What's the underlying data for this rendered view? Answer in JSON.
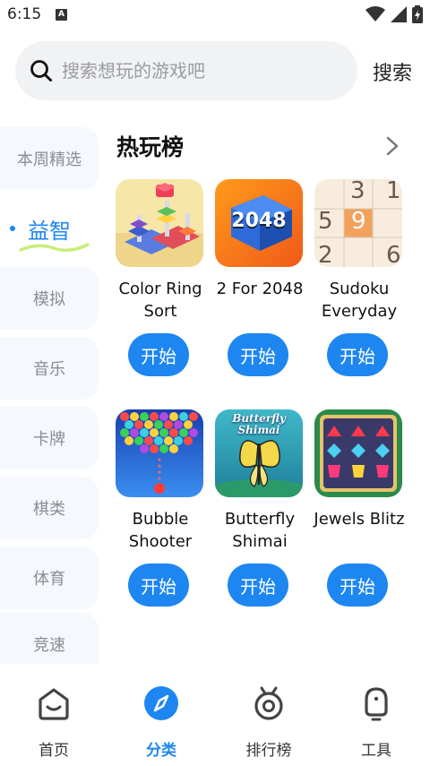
{
  "status_bar": {
    "time": "6:15",
    "notification_badge": "A",
    "icons": [
      "wifi-icon",
      "signal-icon",
      "battery-icon"
    ]
  },
  "search": {
    "placeholder": "搜索想玩的游戏吧",
    "value": "",
    "button_label": "搜索"
  },
  "sidebar": {
    "categories": [
      {
        "label": "本周精选",
        "active": false
      },
      {
        "label": "益智",
        "active": true
      },
      {
        "label": "模拟",
        "active": false
      },
      {
        "label": "音乐",
        "active": false
      },
      {
        "label": "卡牌",
        "active": false
      },
      {
        "label": "棋类",
        "active": false
      },
      {
        "label": "体育",
        "active": false
      },
      {
        "label": "竞速",
        "active": false
      }
    ]
  },
  "section": {
    "title": "热玩榜",
    "more_icon": "chevron-right-icon",
    "games": [
      {
        "name": "Color Ring Sort",
        "button": "开始",
        "icon": "color-ring-sort-icon"
      },
      {
        "name": "2 For 2048",
        "button": "开始",
        "icon": "2048-icon",
        "icon_text": "2048"
      },
      {
        "name": "Sudoku Everyday",
        "button": "开始",
        "icon": "sudoku-icon",
        "icon_digits": [
          "3",
          "1",
          "5",
          "9",
          "2",
          "6"
        ]
      },
      {
        "name": "Bubble Shooter",
        "button": "开始",
        "icon": "bubble-shooter-icon"
      },
      {
        "name": "Butterfly Shimai",
        "button": "开始",
        "icon": "butterfly-icon",
        "icon_text": "Butterfly Shimai"
      },
      {
        "name": "Jewels Blitz",
        "button": "开始",
        "icon": "jewels-icon"
      }
    ]
  },
  "bottom_nav": [
    {
      "label": "首页",
      "icon": "home-icon",
      "active": false
    },
    {
      "label": "分类",
      "icon": "compass-icon",
      "active": true
    },
    {
      "label": "排行榜",
      "icon": "ranking-icon",
      "active": false
    },
    {
      "label": "工具",
      "icon": "tools-icon",
      "active": false
    }
  ],
  "colors": {
    "accent": "#1d86f0",
    "sidebar_bg": "#f5f8fc",
    "search_bg": "#f1f2f4"
  }
}
